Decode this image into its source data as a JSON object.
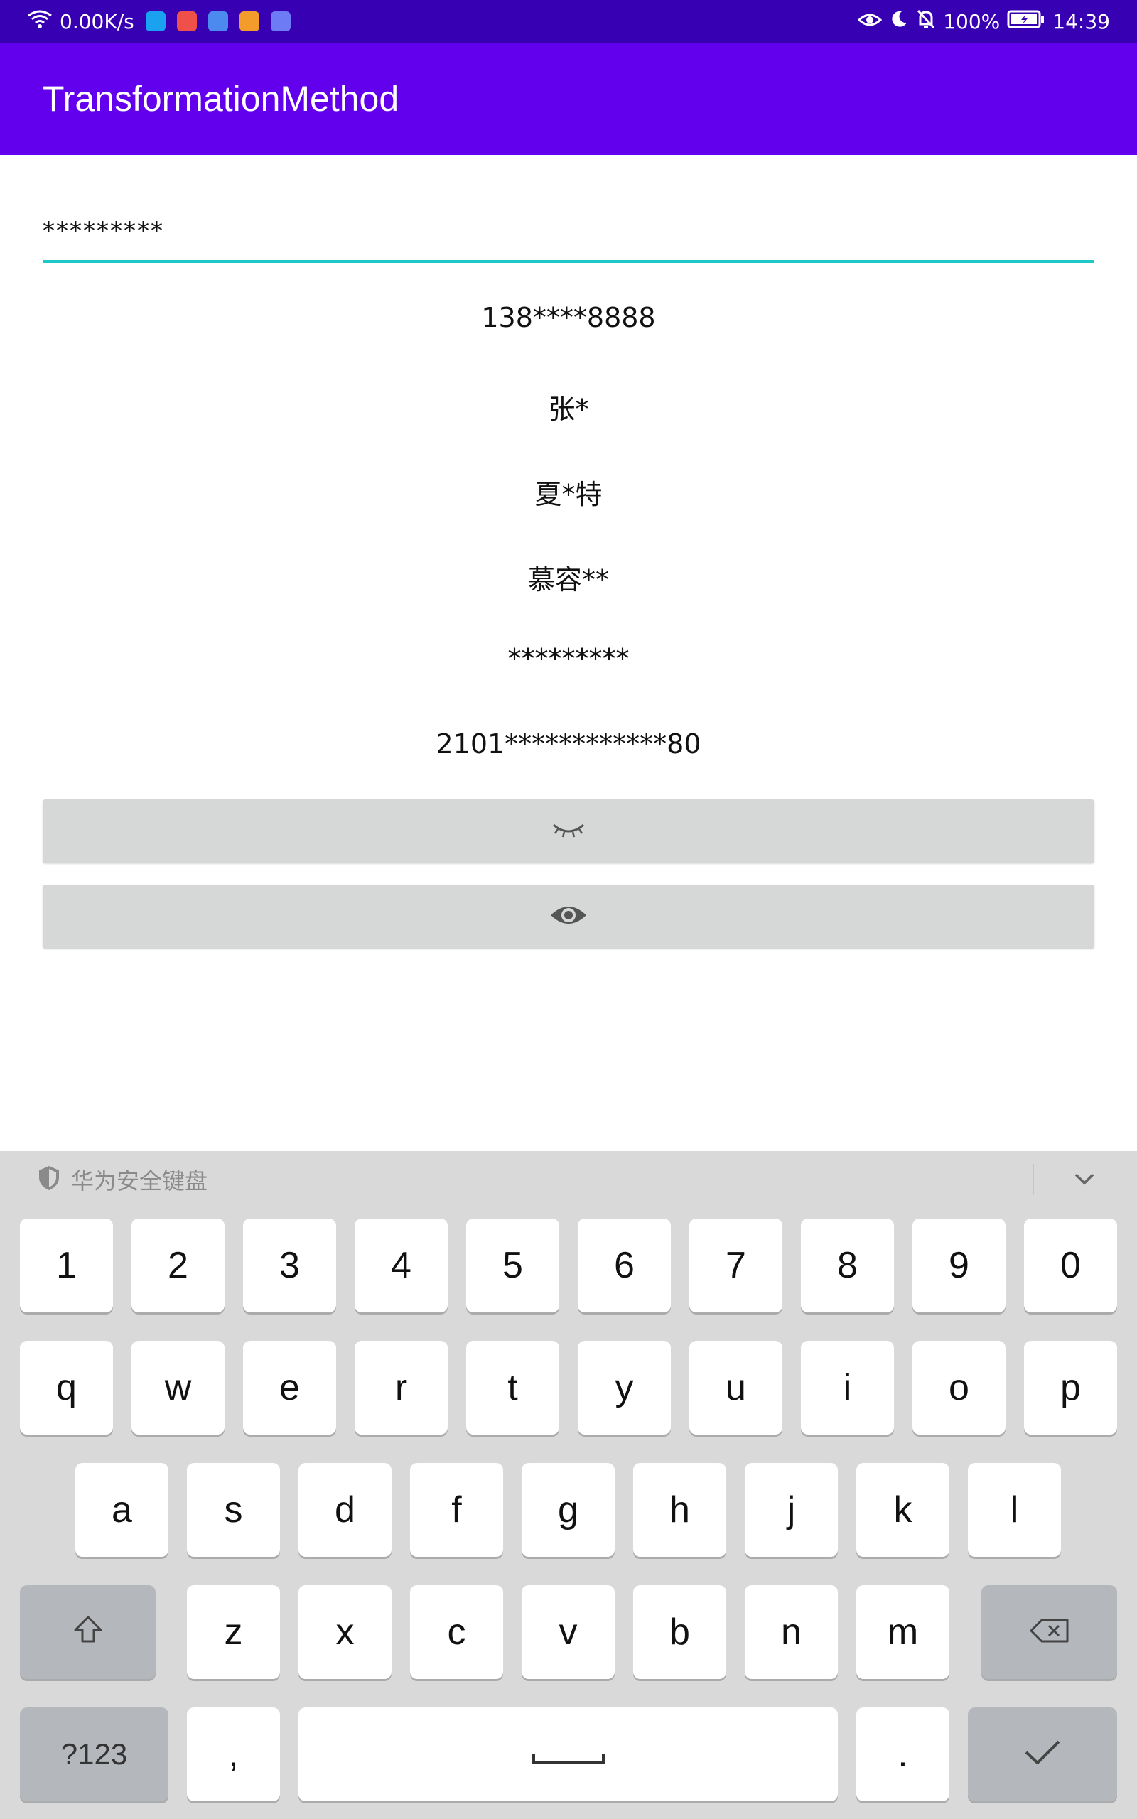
{
  "status_bar": {
    "speed": "0.00K/s",
    "battery": "100%",
    "time": "14:39",
    "icons": [
      "wifi-icon",
      "app-search-icon",
      "app-gallery-icon",
      "app-music-icon",
      "app-video-icon",
      "app-hms-icon",
      "eye-icon",
      "moon-icon",
      "bell-off-icon",
      "battery-icon"
    ]
  },
  "app": {
    "title": "TransformationMethod"
  },
  "input": {
    "value": "*********"
  },
  "masked": {
    "phone": "138****8888",
    "name1": "张*",
    "name2": "夏*特",
    "name3": "慕容**",
    "password": "*********",
    "id": "2101************80"
  },
  "buttons": [
    {
      "icon": "eye-closed-icon"
    },
    {
      "icon": "eye-open-icon"
    }
  ],
  "keyboard": {
    "title": "华为安全键盘",
    "row_numbers": [
      "1",
      "2",
      "3",
      "4",
      "5",
      "6",
      "7",
      "8",
      "9",
      "0"
    ],
    "row1": [
      "q",
      "w",
      "e",
      "r",
      "t",
      "y",
      "u",
      "i",
      "o",
      "p"
    ],
    "row2": [
      "a",
      "s",
      "d",
      "f",
      "g",
      "h",
      "j",
      "k",
      "l"
    ],
    "row3": [
      "z",
      "x",
      "c",
      "v",
      "b",
      "n",
      "m"
    ],
    "sym_label": "?123",
    "comma": ",",
    "period": ".",
    "colors": {
      "bg": "#d9d9d9",
      "key": "#ffffff",
      "special_key": "#b4b7bb"
    }
  },
  "colors": {
    "status_bar": "#3700b3",
    "app_bar": "#6200ee",
    "accent": "#1cc8c8"
  }
}
